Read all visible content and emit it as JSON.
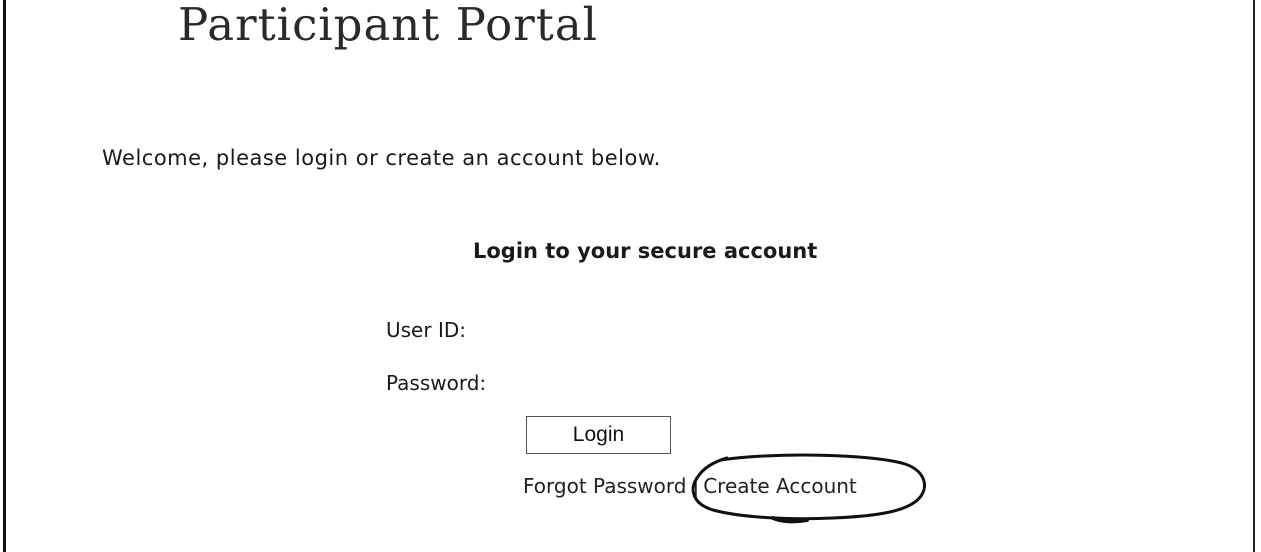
{
  "header": {
    "title": "Participant Portal"
  },
  "main": {
    "welcome_text": "Welcome, please login or create an account below.",
    "login_heading": "Login to your secure account",
    "user_id_label": "User ID:",
    "password_label": "Password:",
    "user_id_value": "",
    "password_value": "",
    "login_button_label": "Login",
    "forgot_password_link": "Forgot Password",
    "separator": "|",
    "create_account_link": "Create Account"
  },
  "colors": {
    "text": "#1a1a1a",
    "annotation_ink": "#111111"
  },
  "icons": {
    "annotation": "hand-drawn-circle"
  }
}
